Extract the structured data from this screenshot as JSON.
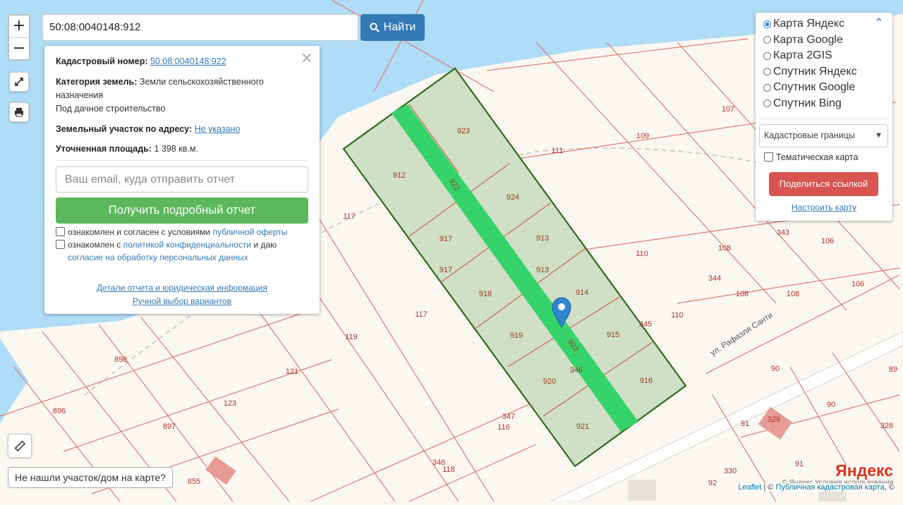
{
  "search": {
    "value": "50:08:0040148:912",
    "button": "Найти"
  },
  "info": {
    "cad_label": "Кадастровый номер:",
    "cad_value": "50:08:0040148:922",
    "cat_label": "Категория земель:",
    "cat_value_1": "Земли сельскохозяйственного",
    "cat_value_2": "назначения",
    "use": "Под дачное строительство",
    "addr_label": "Земельный участок по адресу:",
    "addr_value": "Не указано",
    "area_label": "Уточненная площадь:",
    "area_value": "1 398 кв.м.",
    "email_placeholder": "Ваш email, куда отправить отчет",
    "report_button": "Получить подробный отчет",
    "agree1_text": "ознакомлен и согласен с условиями",
    "agree1_link": "публичной оферты",
    "agree2_text": "ознакомлен с",
    "agree2_link": "политикой конфиденциальности",
    "agree2_tail": "и даю",
    "agree2_link2": "согласие на обработку персональных данных",
    "details_link": "Детали отчета и юридическая информация",
    "manual_link": "Ручной выбор вариантов"
  },
  "layers": {
    "options": [
      "Карта Яндекс",
      "Карта Google",
      "Карта 2GIS",
      "Спутник Яндекс",
      "Спутник Google",
      "Спутник Bing"
    ],
    "selected": "Карта Яндекс",
    "overlay_select": "Кадастровые границы",
    "thematic": "Тематическая карта",
    "share_button": "Поделиться ссылкой",
    "configure_link": "Настроить карту"
  },
  "map": {
    "street": "ул. Рафаэля Санти",
    "labels_selected": [
      "923",
      "912",
      "924",
      "917",
      "913",
      "917",
      "913",
      "918",
      "914",
      "919",
      "915",
      "920",
      "916",
      "921",
      "922",
      "922",
      "346"
    ],
    "labels_other": [
      "107",
      "109",
      "111",
      "117",
      "110",
      "108",
      "343",
      "106",
      "344",
      "108",
      "108",
      "106",
      "117",
      "345",
      "110",
      "119",
      "898",
      "121",
      "123",
      "896",
      "897",
      "855",
      "347",
      "116",
      "348",
      "118",
      "90",
      "89",
      "328",
      "91",
      "330",
      "91",
      "90",
      "92",
      "329"
    ]
  },
  "notfound": "Не нашли участок/дом на карте?",
  "attribution": {
    "leaflet": "Leaflet",
    "pkk": "Публичная кадастровая карта",
    "yandex_logo": "Яндекс",
    "yandex_terms": "© Яндекс  Условия использования"
  },
  "colors": {
    "water": "#afdcf6",
    "parcel_line": "#e07a73",
    "selected_fill": "#cfe0c6",
    "selected_border": "#2f6b1d",
    "strip": "#34d46a",
    "marker": "#2e86d1",
    "find_button": "#337ab7",
    "report_button": "#5cb85c",
    "share_button": "#d9534f"
  }
}
